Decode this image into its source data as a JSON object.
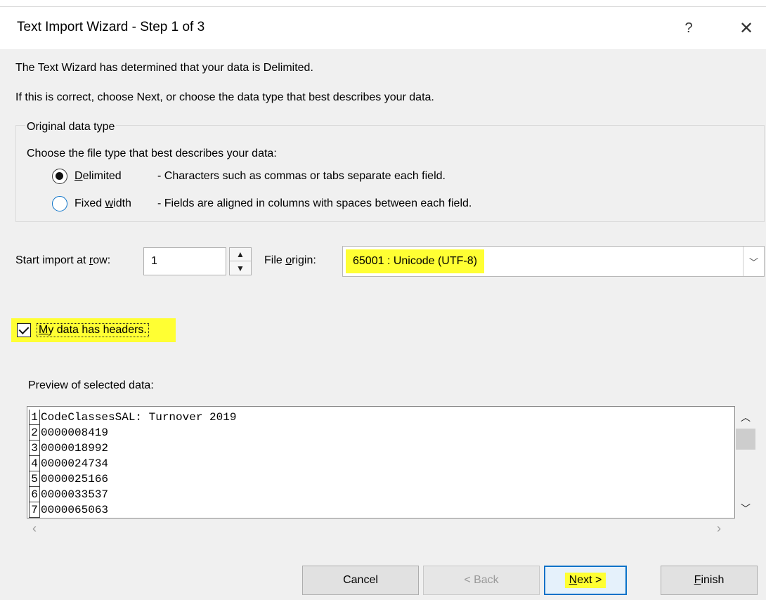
{
  "window": {
    "title": "Text Import Wizard - Step 1 of 3",
    "help_glyph": "?",
    "close_glyph": "✕"
  },
  "intro": {
    "line1": "The Text Wizard has determined that your data is Delimited.",
    "line2": "If this is correct, choose Next, or choose the data type that best describes your data."
  },
  "original_data_type": {
    "legend": "Original data type",
    "prompt": "Choose the file type that best describes your data:",
    "options": [
      {
        "label_pre": "",
        "label_u": "D",
        "label_post": "elimited",
        "description": "- Characters such as commas or tabs separate each field.",
        "selected": true
      },
      {
        "label_pre": "Fixed ",
        "label_u": "w",
        "label_post": "idth",
        "description": "- Fields are aligned in columns with spaces between each field.",
        "selected": false
      }
    ]
  },
  "start_row": {
    "label_pre": "Start import at ",
    "label_u": "r",
    "label_post": "ow:",
    "value": "1"
  },
  "file_origin": {
    "label_pre": "File ",
    "label_u": "o",
    "label_post": "rigin:",
    "value": "65001 : Unicode (UTF-8)",
    "highlight_color": "#ffff33"
  },
  "headers_checkbox": {
    "label_u": "M",
    "label_post": "y data has headers.",
    "checked": true
  },
  "preview": {
    "label": "Preview of selected data:",
    "rows": [
      {
        "num": "1",
        "text": "CodeClassesSAL: Turnover 2019"
      },
      {
        "num": "2",
        "text": "0000008419"
      },
      {
        "num": "3",
        "text": "0000018992"
      },
      {
        "num": "4",
        "text": "0000024734"
      },
      {
        "num": "5",
        "text": "0000025166"
      },
      {
        "num": "6",
        "text": "0000033537"
      },
      {
        "num": "7",
        "text": "0000065063"
      }
    ]
  },
  "buttons": {
    "cancel": "Cancel",
    "back": "< Back",
    "next_u": "N",
    "next_post": "ext >",
    "finish_u": "F",
    "finish_post": "inish"
  },
  "colors": {
    "accent": "#0a72c8",
    "highlight": "#ffff33"
  }
}
